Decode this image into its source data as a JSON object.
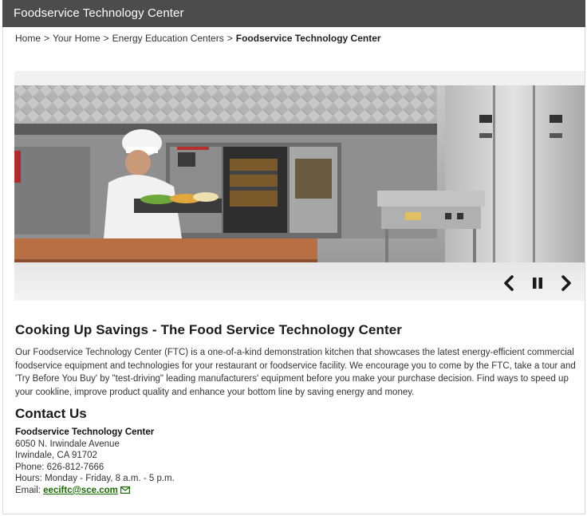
{
  "header": {
    "title": "Foodservice Technology Center"
  },
  "breadcrumb": {
    "items": [
      "Home",
      "Your Home",
      "Energy Education Centers"
    ],
    "separator": ">",
    "current": "Foodservice Technology Center"
  },
  "carousel": {
    "prev_icon": "chevron-left-icon",
    "pause_icon": "pause-icon",
    "next_icon": "chevron-right-icon"
  },
  "main": {
    "headline": "Cooking Up Savings - The Food Service Technology Center",
    "intro": "Our Foodservice Technology Center (FTC) is a one-of-a-kind demonstration kitchen that showcases the latest energy-efficient commercial foodservice equipment and technologies for your restaurant or foodservice facility. We encourage you to come by the FTC, take a tour and 'Try Before You Buy' by \"test-driving\" leading manufacturers' equipment before you make your purchase decision. Find ways to speed up your cookline, improve product quality and enhance your bottom line by saving energy and money."
  },
  "contact": {
    "heading": "Contact Us",
    "org": "Foodservice Technology Center",
    "address1": "6050 N. Irwindale Avenue",
    "address2": "Irwindale, CA 91702",
    "phone": "Phone: 626-812-7666",
    "hours": "Hours: Monday - Friday, 8 a.m. - 5 p.m.",
    "email_label": "Email: ",
    "email": "eeciftc@sce.com",
    "email_icon": "envelope-icon"
  },
  "colors": {
    "titlebar_bg": "#4c4c4c",
    "link_green": "#1a6a00"
  }
}
